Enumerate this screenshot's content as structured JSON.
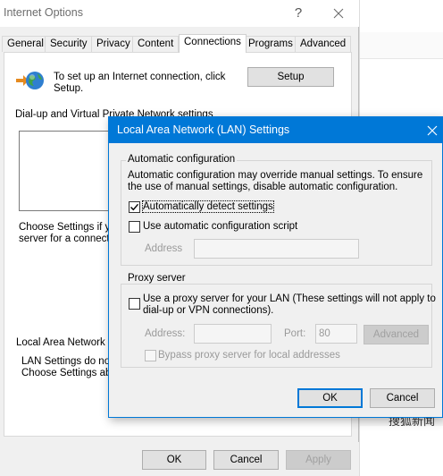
{
  "background": {
    "cjk_text": "搜狐新闻"
  },
  "internet_options": {
    "title": "Internet Options",
    "help_glyph": "?",
    "tabs": [
      {
        "label": "General"
      },
      {
        "label": "Security"
      },
      {
        "label": "Privacy"
      },
      {
        "label": "Content"
      },
      {
        "label": "Connections",
        "active": true
      },
      {
        "label": "Programs"
      },
      {
        "label": "Advanced"
      }
    ],
    "setup_text": "To set up an Internet connection, click Setup.",
    "setup_button": "Setup",
    "dialup_heading": "Dial-up and Virtual Private Network settings",
    "choose_settings_line1": "Choose Settings if yo",
    "choose_settings_line2": "server for a connecti",
    "lan_heading": "Local Area Network (L",
    "lan_note_line1": "LAN Settings do not",
    "lan_note_line2": "Choose Settings abo",
    "buttons": {
      "ok": "OK",
      "cancel": "Cancel",
      "apply": "Apply"
    }
  },
  "lan_settings": {
    "title": "Local Area Network (LAN) Settings",
    "auto_config": {
      "group_label": "Automatic configuration",
      "description": "Automatic configuration may override manual settings.  To ensure the use of manual settings, disable automatic configuration.",
      "auto_detect_label": "Automatically detect settings",
      "auto_detect_checked": true,
      "use_script_label": "Use automatic configuration script",
      "use_script_checked": false,
      "address_label": "Address",
      "address_value": ""
    },
    "proxy": {
      "group_label": "Proxy server",
      "use_proxy_label_line1": "Use a proxy server for your LAN (These settings will not apply to",
      "use_proxy_label_line2": "dial-up or VPN connections).",
      "use_proxy_checked": false,
      "address_label": "Address:",
      "address_value": "",
      "port_label": "Port:",
      "port_value": "80",
      "advanced_button": "Advanced",
      "bypass_label": "Bypass proxy server for local addresses",
      "bypass_checked": false
    },
    "buttons": {
      "ok": "OK",
      "cancel": "Cancel"
    }
  },
  "colors": {
    "accent": "#0078d7",
    "dialog_bg": "#f0f0f0",
    "panel_bg": "#ffffff",
    "disabled_text": "#9a9a9a"
  },
  "icons": {
    "globe": "network-globe-icon",
    "close": "close-icon",
    "check": "checkmark-icon"
  }
}
